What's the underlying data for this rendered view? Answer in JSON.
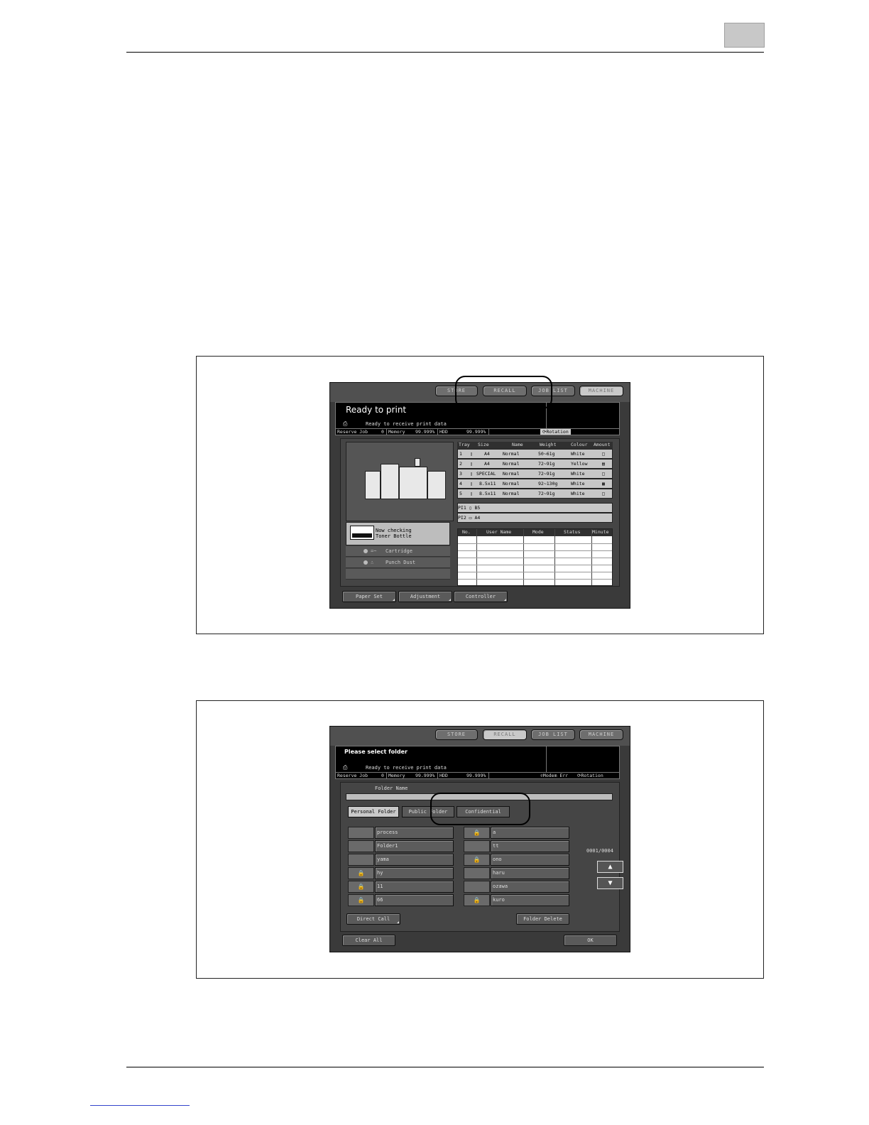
{
  "screen1": {
    "top_buttons": [
      "STORE",
      "RECALL",
      "JOB LIST",
      "MACHINE"
    ],
    "message_title": "Ready to print",
    "message_sub": "Ready to receive print data",
    "status": {
      "reserve_job_label": "Reserve Job",
      "reserve_job_value": "0",
      "memory_label": "Memory",
      "memory_value": "99.999%",
      "hdd_label": "HDD",
      "hdd_value": "99.999%",
      "rotation": "Rotation"
    },
    "tray_headers": [
      "Tray",
      "Size",
      "Name",
      "Weight",
      "Colour",
      "Amount"
    ],
    "trays": [
      {
        "tray": "1",
        "size": "A4",
        "name": "Normal",
        "weight": "50~61g",
        "colour": "White"
      },
      {
        "tray": "2",
        "size": "A4",
        "name": "Normal",
        "weight": "72~91g",
        "colour": "Yellow"
      },
      {
        "tray": "3",
        "size": "SPECIAL",
        "name": "Normal",
        "weight": "72~91g",
        "colour": "White"
      },
      {
        "tray": "4",
        "size": "8.5x11",
        "name": "Normal",
        "weight": "92~130g",
        "colour": "White"
      },
      {
        "tray": "5",
        "size": "8.5x11",
        "name": "Normal",
        "weight": "72~91g",
        "colour": "White"
      }
    ],
    "pi_rows": [
      {
        "label": "PI1",
        "size": "B5"
      },
      {
        "label": "PI2",
        "size": "A4"
      }
    ],
    "job_headers": [
      "No.",
      "User Name",
      "Mode",
      "Status",
      "Minute"
    ],
    "notice_line1": "Now checking",
    "notice_line2": "Toner Bottle",
    "supplies": [
      {
        "icon": "=~",
        "label": "Cartridge"
      },
      {
        "icon": "∴",
        "label": "Punch Dust"
      }
    ],
    "bottom_buttons": [
      "Paper Set",
      "Adjustment",
      "Controller"
    ]
  },
  "screen2": {
    "top_buttons": [
      "STORE",
      "RECALL",
      "JOB LIST",
      "MACHINE"
    ],
    "message_title": "Please select folder",
    "message_sub": "Ready to receive print data",
    "status": {
      "reserve_job_label": "Reserve Job",
      "reserve_job_value": "0",
      "memory_label": "Memory",
      "memory_value": "99.999%",
      "hdd_label": "HDD",
      "hdd_value": "99.999%",
      "modem": "Modem Err",
      "rotation": "Rotation"
    },
    "folder_name_label": "Folder Name",
    "tabs": [
      "Personal Folder",
      "Public Folder",
      "Confidential"
    ],
    "left_folders": [
      {
        "name": "process",
        "locked": false
      },
      {
        "name": "Folder1",
        "locked": false
      },
      {
        "name": "yama",
        "locked": false
      },
      {
        "name": "hy",
        "locked": true
      },
      {
        "name": "11",
        "locked": true
      },
      {
        "name": "66",
        "locked": true
      }
    ],
    "right_folders": [
      {
        "name": "a",
        "locked": true
      },
      {
        "name": "tt",
        "locked": false
      },
      {
        "name": "ono",
        "locked": true
      },
      {
        "name": "haru",
        "locked": false
      },
      {
        "name": "ozawa",
        "locked": false
      },
      {
        "name": "kuro",
        "locked": true
      }
    ],
    "page_indicator": "0001/0004",
    "direct_call": "Direct Call",
    "folder_delete": "Folder Delete",
    "clear_all": "Clear All",
    "ok": "OK"
  }
}
